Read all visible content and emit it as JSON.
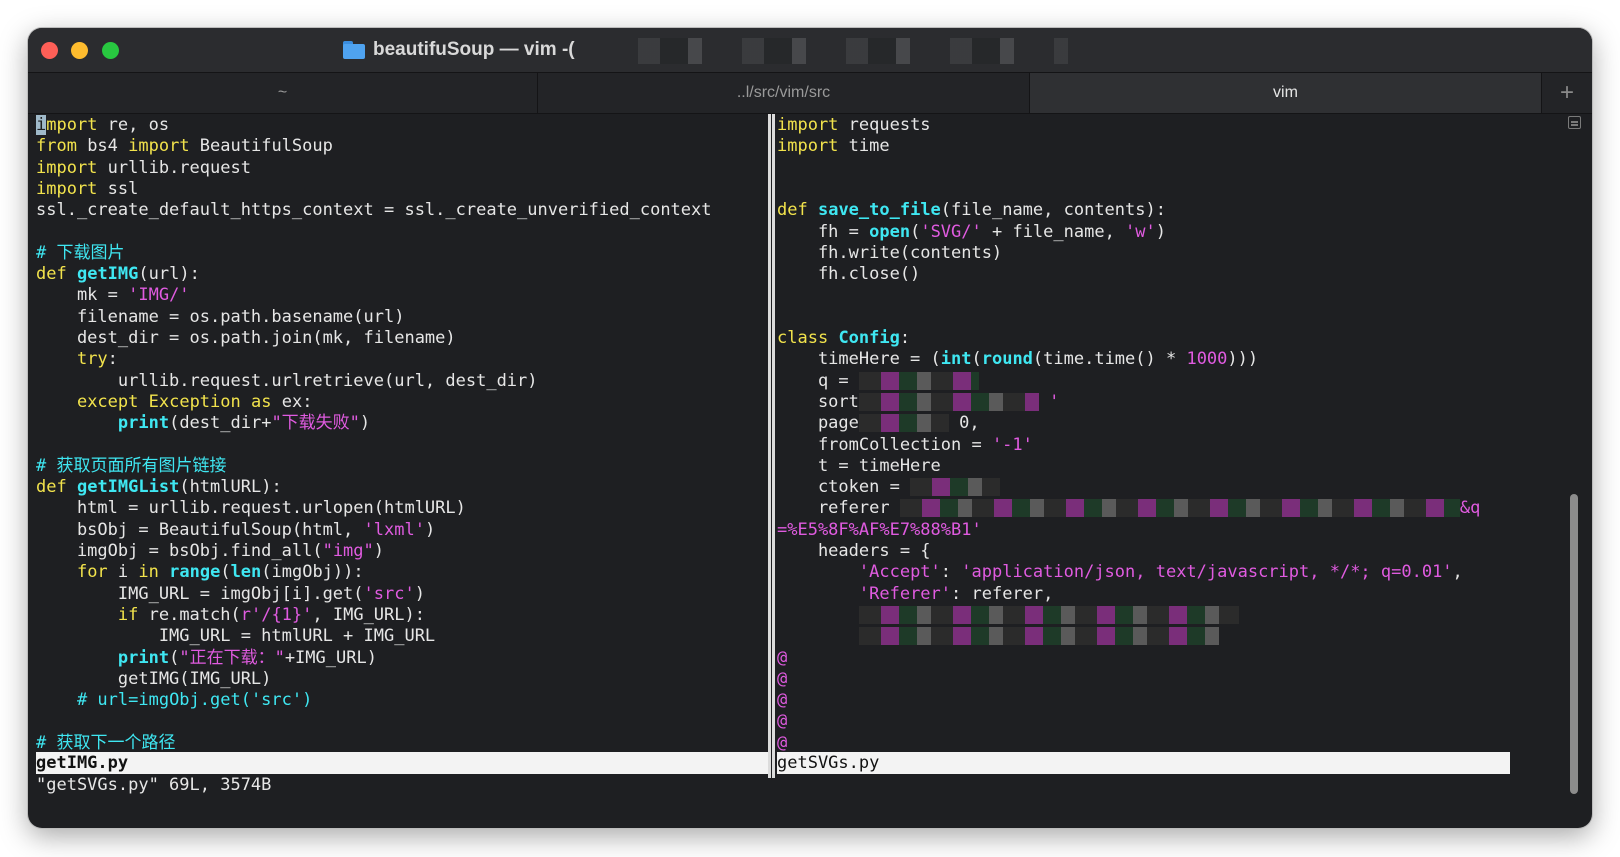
{
  "window": {
    "title": "beautifuSoup — vim -("
  },
  "tabs": [
    {
      "label": "~"
    },
    {
      "label": "..l/src/vim/src"
    },
    {
      "label": "vim"
    }
  ],
  "tab_add_label": "+",
  "left_pane": {
    "filename": "getIMG.py",
    "lines": [
      [
        [
          "import",
          "kw"
        ],
        [
          " re, os",
          ""
        ]
      ],
      [
        [
          "from",
          "kw"
        ],
        [
          " bs4 ",
          ""
        ],
        [
          "import",
          "kw"
        ],
        [
          " BeautifulSoup",
          ""
        ]
      ],
      [
        [
          "import",
          "kw"
        ],
        [
          " urllib.request",
          ""
        ]
      ],
      [
        [
          "import",
          "kw"
        ],
        [
          " ssl",
          ""
        ]
      ],
      [
        [
          "ssl._create_default_https_context = ssl._create_unverified_context",
          ""
        ]
      ],
      [],
      [
        [
          "# 下载图片",
          "cm"
        ]
      ],
      [
        [
          "def",
          "kw"
        ],
        [
          " ",
          ""
        ],
        [
          "getIMG",
          "fn"
        ],
        [
          "(url):",
          ""
        ]
      ],
      [
        [
          "    mk = ",
          ""
        ],
        [
          "'IMG/'",
          "str"
        ]
      ],
      [
        [
          "    filename = os.path.basename(url)",
          ""
        ]
      ],
      [
        [
          "    dest_dir = os.path.join(mk, filename)",
          ""
        ]
      ],
      [
        [
          "    ",
          ""
        ],
        [
          "try",
          "kw"
        ],
        [
          ":",
          ""
        ]
      ],
      [
        [
          "        urllib.request.urlretrieve(url, dest_dir)",
          ""
        ]
      ],
      [
        [
          "    ",
          ""
        ],
        [
          "except",
          "kw"
        ],
        [
          " ",
          ""
        ],
        [
          "Exception",
          "kw"
        ],
        [
          " ",
          ""
        ],
        [
          "as",
          "kw"
        ],
        [
          " ex:",
          ""
        ]
      ],
      [
        [
          "        ",
          ""
        ],
        [
          "print",
          "bi"
        ],
        [
          "(dest_dir+",
          ""
        ],
        [
          "\"下载失败\"",
          "str"
        ],
        [
          ")",
          ""
        ]
      ],
      [],
      [
        [
          "# 获取页面所有图片链接",
          "cm"
        ]
      ],
      [
        [
          "def",
          "kw"
        ],
        [
          " ",
          ""
        ],
        [
          "getIMGList",
          "fn"
        ],
        [
          "(htmlURL):",
          ""
        ]
      ],
      [
        [
          "    html = urllib.request.urlopen(htmlURL)",
          ""
        ]
      ],
      [
        [
          "    bsObj = BeautifulSoup(html, ",
          ""
        ],
        [
          "'lxml'",
          "str"
        ],
        [
          ")",
          ""
        ]
      ],
      [
        [
          "    imgObj = bsObj.find_all(",
          ""
        ],
        [
          "\"img\"",
          "str"
        ],
        [
          ")",
          ""
        ]
      ],
      [
        [
          "    ",
          ""
        ],
        [
          "for",
          "kw"
        ],
        [
          " i ",
          ""
        ],
        [
          "in",
          "kw"
        ],
        [
          " ",
          ""
        ],
        [
          "range",
          "bi"
        ],
        [
          "(",
          ""
        ],
        [
          "len",
          "bi"
        ],
        [
          "(imgObj)):",
          ""
        ]
      ],
      [
        [
          "        IMG_URL = imgObj[i].get(",
          ""
        ],
        [
          "'src'",
          "str"
        ],
        [
          ")",
          ""
        ]
      ],
      [
        [
          "        ",
          ""
        ],
        [
          "if",
          "kw"
        ],
        [
          " re.match(",
          ""
        ],
        [
          "r'/{1}'",
          "str"
        ],
        [
          ", IMG_URL):",
          ""
        ]
      ],
      [
        [
          "            IMG_URL = htmlURL + IMG_URL",
          ""
        ]
      ],
      [
        [
          "        ",
          ""
        ],
        [
          "print",
          "bi"
        ],
        [
          "(",
          ""
        ],
        [
          "\"正在下载：\"",
          "str"
        ],
        [
          "+IMG_URL)",
          ""
        ]
      ],
      [
        [
          "        getIMG(IMG_URL)",
          ""
        ]
      ],
      [
        [
          "    ",
          ""
        ],
        [
          "# url=imgObj.get('src')",
          "cm"
        ]
      ],
      [],
      [
        [
          "# 获取下一个路径",
          "cm"
        ]
      ]
    ]
  },
  "right_pane": {
    "filename": "getSVGs.py",
    "lines": [
      [
        [
          "import",
          "kw"
        ],
        [
          " requests",
          ""
        ]
      ],
      [
        [
          "import",
          "kw"
        ],
        [
          " time",
          ""
        ]
      ],
      [],
      [],
      [
        [
          "def",
          "kw"
        ],
        [
          " ",
          ""
        ],
        [
          "save_to_file",
          "fn"
        ],
        [
          "(file_name, contents):",
          ""
        ]
      ],
      [
        [
          "    fh = ",
          ""
        ],
        [
          "open",
          "bi"
        ],
        [
          "(",
          ""
        ],
        [
          "'SVG/'",
          "str"
        ],
        [
          " + file_name, ",
          ""
        ],
        [
          "'w'",
          "str"
        ],
        [
          ")",
          ""
        ]
      ],
      [
        [
          "    fh.write(contents)",
          ""
        ]
      ],
      [
        [
          "    fh.close()",
          ""
        ]
      ],
      [],
      [],
      [
        [
          "class",
          "kw"
        ],
        [
          " ",
          ""
        ],
        [
          "Config",
          "fn"
        ],
        [
          ":",
          ""
        ]
      ],
      [
        [
          "    timeHere = (",
          ""
        ],
        [
          "int",
          "bi"
        ],
        [
          "(",
          ""
        ],
        [
          "round",
          "bi"
        ],
        [
          "(time.time() * ",
          ""
        ],
        [
          "1000",
          "num"
        ],
        [
          ")))",
          ""
        ]
      ],
      [
        [
          "    q = ",
          ""
        ],
        [
          "",
          "r120"
        ]
      ],
      [
        [
          "    sort",
          ""
        ],
        [
          "",
          "r180"
        ],
        [
          " '",
          "str"
        ]
      ],
      [
        [
          "    page",
          ""
        ],
        [
          "",
          "r90"
        ],
        [
          " 0,",
          ""
        ]
      ],
      [
        [
          "    fromCollection = ",
          ""
        ],
        [
          "'-1'",
          "str"
        ]
      ],
      [
        [
          "    t = timeHere",
          ""
        ]
      ],
      [
        [
          "    ctoken = ",
          ""
        ],
        [
          "",
          "r90"
        ]
      ],
      [
        [
          "    referer ",
          ""
        ],
        [
          "",
          "r560"
        ],
        [
          "&q",
          "str"
        ]
      ],
      [
        [
          "=%E5%8F%AF%E7%88%B1'",
          "str"
        ]
      ],
      [
        [
          "    headers = {",
          ""
        ]
      ],
      [
        [
          "        ",
          ""
        ],
        [
          "'Accept'",
          "str"
        ],
        [
          ": ",
          ""
        ],
        [
          "'application/json, text/javascript, */*; q=0.01'",
          "str"
        ],
        [
          ",",
          ""
        ]
      ],
      [
        [
          "        ",
          ""
        ],
        [
          "'Referer'",
          "str"
        ],
        [
          ": referer,",
          ""
        ]
      ],
      [
        [
          "        ",
          ""
        ],
        [
          "",
          "r380"
        ]
      ],
      [
        [
          "        ",
          ""
        ],
        [
          "",
          "r360"
        ]
      ],
      [
        [
          "@",
          "tilde"
        ]
      ],
      [
        [
          "@",
          "tilde"
        ]
      ],
      [
        [
          "@",
          "tilde"
        ]
      ],
      [
        [
          "@",
          "tilde"
        ]
      ],
      [
        [
          "@",
          "tilde"
        ]
      ]
    ]
  },
  "command_line": "\"getSVGs.py\" 69L, 3574B",
  "colors": {
    "keyword": "#f2e34c",
    "function": "#3fe7f2",
    "string": "#e05be0",
    "comment": "#3fe7f2",
    "background": "#1e1f22"
  }
}
